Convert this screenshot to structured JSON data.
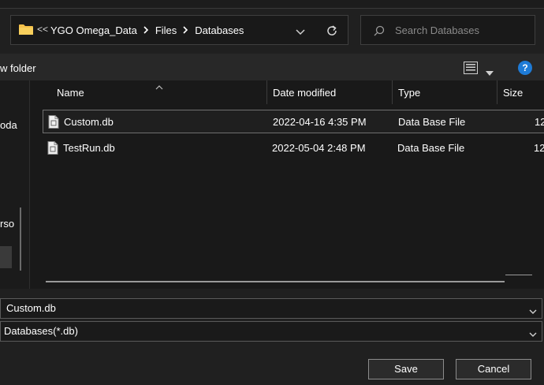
{
  "address_bar": {
    "overflow_marker": "<<",
    "crumbs": [
      "YGO Omega_Data",
      "Files",
      "Databases"
    ]
  },
  "search": {
    "placeholder": "Search Databases"
  },
  "toolbar": {
    "new_folder_label": "w folder",
    "help_label": "?"
  },
  "nav": {
    "items": [
      "oda",
      "rso"
    ]
  },
  "columns": {
    "name": "Name",
    "date": "Date modified",
    "type": "Type",
    "size": "Size"
  },
  "files": [
    {
      "name": "Custom.db",
      "date": "2022-04-16 4:35 PM",
      "type": "Data Base File",
      "size": "12",
      "selected": true
    },
    {
      "name": "TestRun.db",
      "date": "2022-05-04 2:48 PM",
      "type": "Data Base File",
      "size": "12",
      "selected": false
    }
  ],
  "footer": {
    "filename_value": "Custom.db",
    "filetype_value": "Databases(*.db)",
    "save_label": "Save",
    "cancel_label": "Cancel"
  },
  "icons": [
    "folder-icon",
    "chevron-right-icon",
    "chevron-down-icon",
    "refresh-icon",
    "search-icon",
    "view-details-icon",
    "help-icon",
    "file-icon",
    "sort-up-icon"
  ],
  "colors": {
    "background": "#202020",
    "list_background": "#191919",
    "accent_help": "#1e7bd6"
  }
}
